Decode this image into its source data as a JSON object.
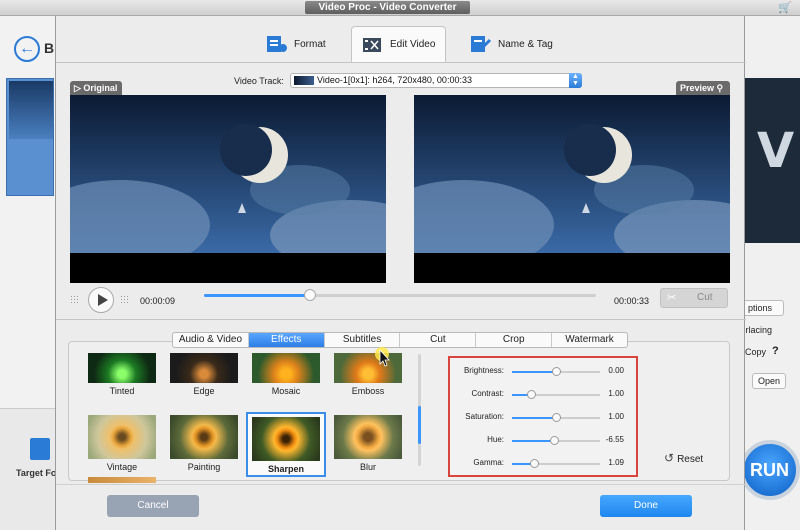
{
  "app": {
    "title": "Video Proc - Video Converter"
  },
  "top_tabs": [
    {
      "label": "Format",
      "icon": "format-icon",
      "active": false
    },
    {
      "label": "Edit Video",
      "icon": "edit-video-icon",
      "active": true
    },
    {
      "label": "Name & Tag",
      "icon": "name-tag-icon",
      "active": false
    }
  ],
  "video_track": {
    "label": "Video Track:",
    "value": "Video-1[0x1]: h264, 720x480, 00:00:33"
  },
  "original_label": "Original",
  "preview_label": "Preview",
  "player": {
    "current_time": "00:00:09",
    "end_time": "00:00:33",
    "progress": 0.27,
    "cut_label": "Cut"
  },
  "edit_tabs": [
    {
      "label": "Audio & Video",
      "active": false
    },
    {
      "label": "Effects",
      "active": true
    },
    {
      "label": "Subtitles",
      "active": false
    },
    {
      "label": "Cut",
      "active": false
    },
    {
      "label": "Crop",
      "active": false
    },
    {
      "label": "Watermark",
      "active": false
    }
  ],
  "effects": [
    {
      "label": "Tinted"
    },
    {
      "label": "Edge"
    },
    {
      "label": "Mosaic"
    },
    {
      "label": "Emboss"
    },
    {
      "label": "Vintage"
    },
    {
      "label": "Painting"
    },
    {
      "label": "Sharpen",
      "selected": true
    },
    {
      "label": "Blur"
    }
  ],
  "adjustments": [
    {
      "label": "Brightness:",
      "value": "0.00",
      "level": 0.5
    },
    {
      "label": "Contrast:",
      "value": "1.00",
      "level": 0.22
    },
    {
      "label": "Saturation:",
      "value": "1.00",
      "level": 0.5
    },
    {
      "label": "Hue:",
      "value": "-6.55",
      "level": 0.48
    },
    {
      "label": "Gamma:",
      "value": "1.09",
      "level": 0.25
    }
  ],
  "reset_label": "Reset",
  "buttons": {
    "cancel": "Cancel",
    "done": "Done"
  },
  "background": {
    "back_letter": "B",
    "target_format": "Target For",
    "options": "ptions",
    "interlacing": "terlacing",
    "copy": "Copy",
    "help": "?",
    "open": "Open",
    "run": "RUN"
  },
  "colors": {
    "accent": "#2c7fe6",
    "highlight_box": "#d9453d"
  }
}
